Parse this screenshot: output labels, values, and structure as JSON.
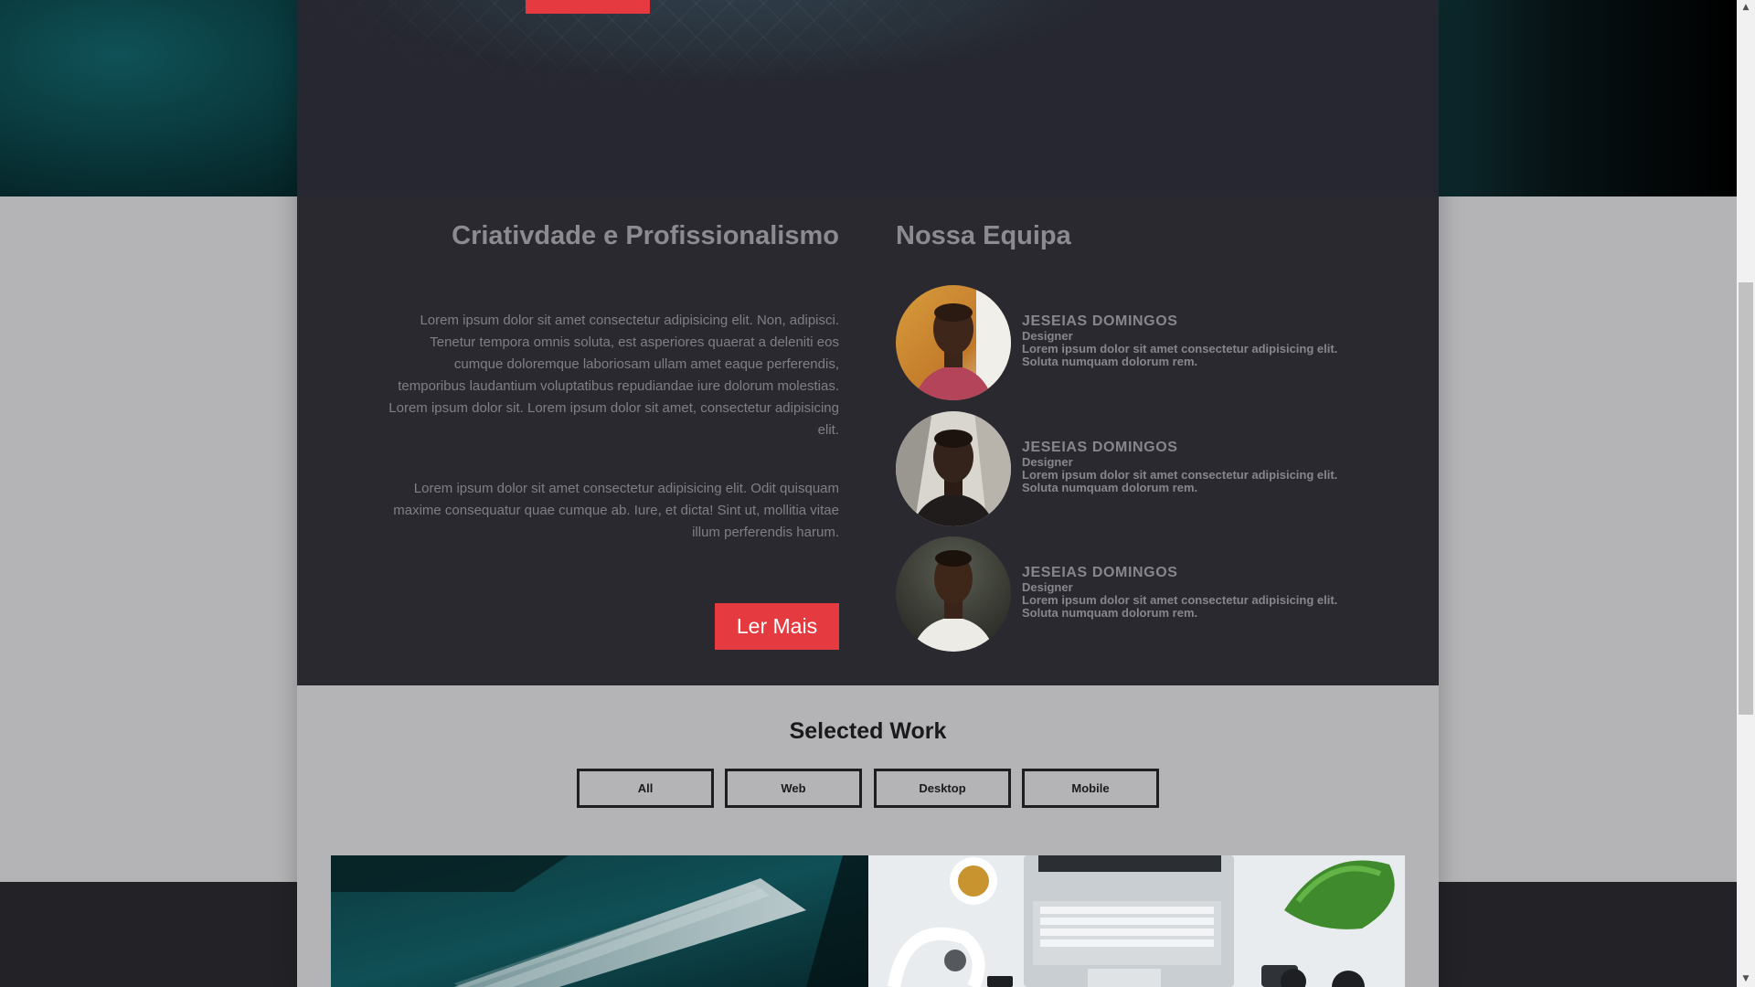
{
  "about": {
    "title": "Criativdade e Profissionalismo",
    "paragraph1": "Lorem ipsum dolor sit amet consectetur adipisicing elit. Non, adipisci. Tenetur tempora omnis soluta, est asperiores quaerat a deleniti eos cumque doloremque laboriosam ullam amet eaque perferendis, temporibus laudantium voluptatibus repudiandae iure dolorum molestias. Lorem ipsum dolor sit. Lorem ipsum dolor sit amet, consectetur adipisicing elit.",
    "paragraph2": "Lorem ipsum dolor sit amet consectetur adipisicing elit. Odit quisquam maxime consequatur quae cumque ab. Iure, et dicta! Sint ut, mollitia vitae illum perferendis harum.",
    "button_label": "Ler Mais"
  },
  "team": {
    "title": "Nossa Equipa",
    "members": [
      {
        "name": "JESEIAS DOMINGOS",
        "role": "Designer",
        "desc_line1": "Lorem ipsum dolor sit amet consectetur adipisicing elit.",
        "desc_line2": "Soluta numquam dolorum rem."
      },
      {
        "name": "JESEIAS DOMINGOS",
        "role": "Designer",
        "desc_line1": "Lorem ipsum dolor sit amet consectetur adipisicing elit.",
        "desc_line2": "Soluta numquam dolorum rem."
      },
      {
        "name": "JESEIAS DOMINGOS",
        "role": "Designer",
        "desc_line1": "Lorem ipsum dolor sit amet consectetur adipisicing elit.",
        "desc_line2": "Soluta numquam dolorum rem."
      }
    ]
  },
  "work": {
    "title": "Selected Work",
    "filters": [
      "All",
      "Web",
      "Desktop",
      "Mobile"
    ]
  },
  "colors": {
    "accent": "#e53a40",
    "dark_section": "#2a2930",
    "light_section": "#b4b3b5"
  },
  "scrollbar": {
    "up_icon": "scroll-up-arrow-icon",
    "down_icon": "scroll-down-arrow-icon"
  }
}
